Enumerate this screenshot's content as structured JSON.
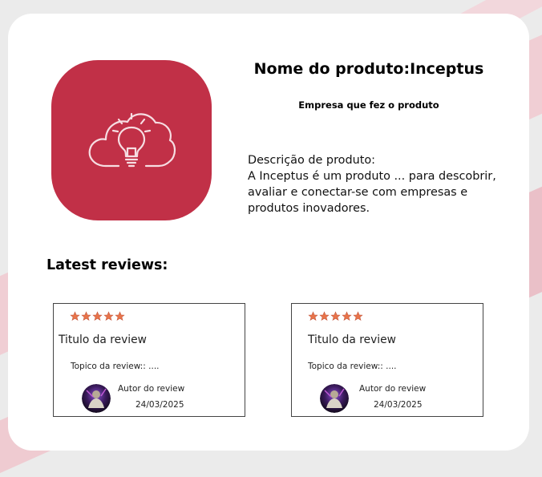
{
  "product": {
    "title": "Nome do produto:Inceptus",
    "company": "Empresa que fez o produto",
    "description_label": "Descrição de produto:",
    "description_text": "A Inceptus é um produto ... para descobrir, avaliar e conectar-se com empresas e produtos inovadores.",
    "logo_icon": "cloud-lightbulb-icon",
    "logo_color": "#c13047"
  },
  "reviews_section": {
    "heading": "Latest reviews:"
  },
  "reviews": [
    {
      "rating": 5,
      "title": "Titulo da review",
      "topic": "Topico da review:: ....",
      "author": "Autor do review",
      "date": "24/03/2025"
    },
    {
      "rating": 5,
      "title": "Titulo da review",
      "topic": "Topico da review:: ....",
      "author": "Autor do review",
      "date": "24/03/2025"
    }
  ],
  "colors": {
    "accent": "#c13047",
    "star": "#e8744a",
    "background_stripe": "#f1c9d0"
  }
}
